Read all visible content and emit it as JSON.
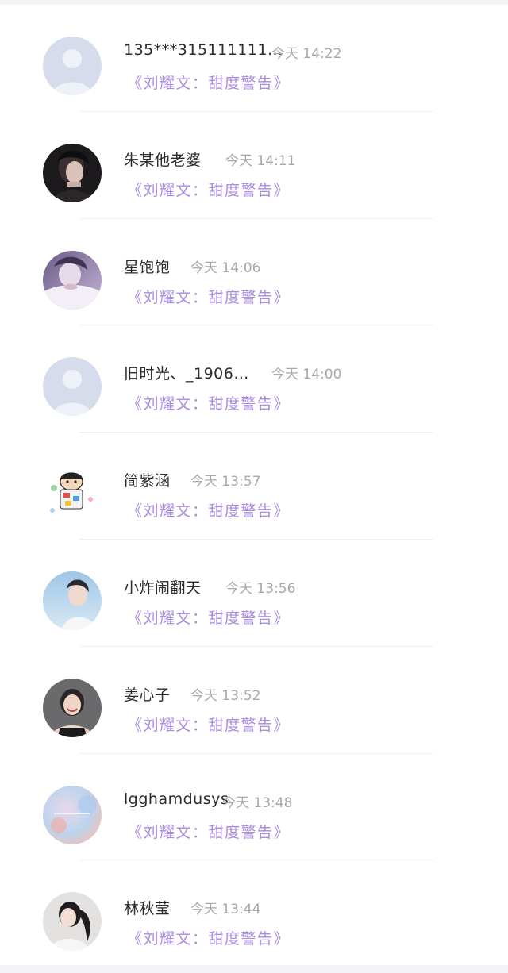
{
  "messages": [
    {
      "name": "135***315111111…",
      "time": "今天  14:22",
      "preview": "《刘耀文：甜度警告》",
      "avatar": "default-avatar-icon"
    },
    {
      "name": "朱某他老婆",
      "time": "今天  14:11",
      "preview": "《刘耀文：甜度警告》",
      "avatar": "dark-portrait"
    },
    {
      "name": "星饱饱",
      "time": "今天  14:06",
      "preview": "《刘耀文：甜度警告》",
      "avatar": "purple-photo"
    },
    {
      "name": "旧时光、_1906…",
      "time": "今天  14:00",
      "preview": "《刘耀文：甜度警告》",
      "avatar": "default-avatar-icon"
    },
    {
      "name": "简紫涵",
      "time": "今天  13:57",
      "preview": "《刘耀文：甜度警告》",
      "avatar": "cartoon-sticker"
    },
    {
      "name": "小炸闹翻天",
      "time": "今天  13:56",
      "preview": "《刘耀文：甜度警告》",
      "avatar": "blue-portrait"
    },
    {
      "name": "姜心子",
      "time": "今天  13:52",
      "preview": "《刘耀文：甜度警告》",
      "avatar": "smiling-girl"
    },
    {
      "name": "lgghamdusys",
      "time": "今天  13:48",
      "preview": "《刘耀文：甜度警告》",
      "avatar": "pastel-blur"
    },
    {
      "name": "林秋莹",
      "time": "今天  13:44",
      "preview": "《刘耀文：甜度警告》",
      "avatar": "ponytail-girl"
    }
  ],
  "colors": {
    "preview_text": "#a98be0",
    "name_text": "#2b2b2b",
    "time_text": "#a8a8a8",
    "default_avatar_bg": "#d6dcec"
  }
}
